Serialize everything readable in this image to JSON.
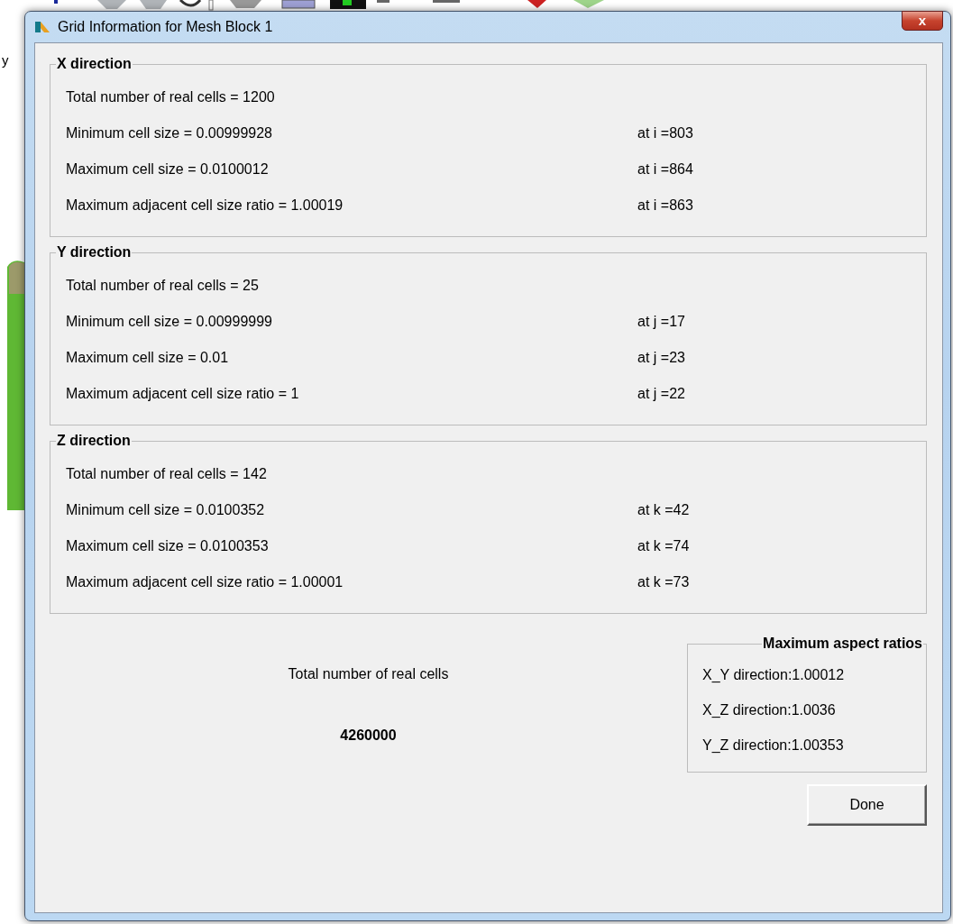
{
  "background": {
    "axis_label": "y"
  },
  "window": {
    "title": "Grid Information for Mesh Block 1",
    "close": "x"
  },
  "groups": [
    {
      "title": "X direction",
      "rows": [
        {
          "label": "Total number of real cells = 1200"
        },
        {
          "label": "Minimum cell size = 0.00999928",
          "location": "at i =803"
        },
        {
          "label": "Maximum cell size = 0.0100012",
          "location": "at i =864"
        },
        {
          "label": "Maximum adjacent cell size ratio = 1.00019",
          "location": "at i =863"
        }
      ]
    },
    {
      "title": "Y direction",
      "rows": [
        {
          "label": "Total number of real cells = 25"
        },
        {
          "label": "Minimum cell size = 0.00999999",
          "location": "at j =17"
        },
        {
          "label": "Maximum cell size = 0.01",
          "location": "at j =23"
        },
        {
          "label": "Maximum adjacent  cell size ratio = 1",
          "location": "at j =22"
        }
      ]
    },
    {
      "title": "Z direction",
      "rows": [
        {
          "label": "Total number of real cells = 142"
        },
        {
          "label": "Minimum cell size = 0.0100352",
          "location": "at k =42"
        },
        {
          "label": "Maximum cell size = 0.0100353",
          "location": "at k =74"
        },
        {
          "label": "Maximum adjacent cell size ratio = 1.00001",
          "location": "at k =73"
        }
      ]
    }
  ],
  "total": {
    "label": "Total number of real cells",
    "value": "4260000"
  },
  "aspect": {
    "title": "Maximum aspect ratios",
    "items": [
      "X_Y direction:1.00012",
      "X_Z direction:1.0036",
      "Y_Z direction:1.00353"
    ]
  },
  "buttons": [
    "Done"
  ]
}
